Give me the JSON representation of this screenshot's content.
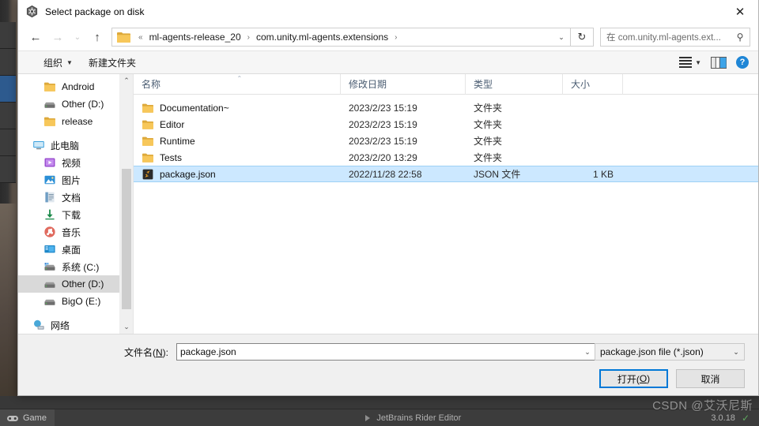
{
  "window": {
    "title": "Select package on disk",
    "app_icon": "unity-logo-icon",
    "close_label": "✕"
  },
  "nav": {
    "back_label": "←",
    "forward_label": "→",
    "recent_label": "⌄",
    "up_label": "↑",
    "refresh_label": "↻",
    "dropdown_label": "⌄",
    "breadcrumb": {
      "prefix": "«",
      "items": [
        "ml-agents-release_20",
        "com.unity.ml-agents.extensions"
      ],
      "separator": "›",
      "trailing_separator": "›"
    },
    "search": {
      "placeholder": "在 com.unity.ml-agents.ext...",
      "icon": "⚲"
    }
  },
  "command_bar": {
    "organize_label": "组织",
    "organize_caret": "▼",
    "new_folder_label": "新建文件夹",
    "view_caret": "▼",
    "help_label": "?"
  },
  "sidebar": {
    "items": [
      {
        "label": "Android",
        "icon": "folder-icon",
        "indent": true,
        "selected": false
      },
      {
        "label": "Other (D:)",
        "icon": "drive-icon",
        "indent": true,
        "selected": false
      },
      {
        "label": "release",
        "icon": "folder-icon",
        "indent": true,
        "selected": false
      },
      {
        "label": "此电脑",
        "icon": "this-pc-icon",
        "indent": false,
        "selected": false
      },
      {
        "label": "视频",
        "icon": "videos-icon",
        "indent": true,
        "selected": false
      },
      {
        "label": "图片",
        "icon": "pictures-icon",
        "indent": true,
        "selected": false
      },
      {
        "label": "文档",
        "icon": "documents-icon",
        "indent": true,
        "selected": false
      },
      {
        "label": "下载",
        "icon": "downloads-icon",
        "indent": true,
        "selected": false
      },
      {
        "label": "音乐",
        "icon": "music-icon",
        "indent": true,
        "selected": false
      },
      {
        "label": "桌面",
        "icon": "desktop-icon",
        "indent": true,
        "selected": false
      },
      {
        "label": "系统 (C:)",
        "icon": "system-drive-icon",
        "indent": true,
        "selected": false
      },
      {
        "label": "Other (D:)",
        "icon": "drive-icon",
        "indent": true,
        "selected": true
      },
      {
        "label": "BigO (E:)",
        "icon": "drive-icon",
        "indent": true,
        "selected": false
      },
      {
        "label": "网络",
        "icon": "network-icon",
        "indent": false,
        "selected": false
      }
    ],
    "scroll_up": "⌃",
    "scroll_down": "⌄"
  },
  "file_list": {
    "columns": [
      "名称",
      "修改日期",
      "类型",
      "大小"
    ],
    "sort_indicator": "⌃",
    "rows": [
      {
        "name": "Documentation~",
        "date": "2023/2/23 15:19",
        "type": "文件夹",
        "size": "",
        "icon": "folder-icon",
        "selected": false
      },
      {
        "name": "Editor",
        "date": "2023/2/23 15:19",
        "type": "文件夹",
        "size": "",
        "icon": "folder-icon",
        "selected": false
      },
      {
        "name": "Runtime",
        "date": "2023/2/23 15:19",
        "type": "文件夹",
        "size": "",
        "icon": "folder-icon",
        "selected": false
      },
      {
        "name": "Tests",
        "date": "2023/2/20 13:29",
        "type": "文件夹",
        "size": "",
        "icon": "folder-icon",
        "selected": false
      },
      {
        "name": "package.json",
        "date": "2022/11/28 22:58",
        "type": "JSON 文件",
        "size": "1 KB",
        "icon": "json-file-icon",
        "selected": true
      }
    ]
  },
  "footer": {
    "filename_label_prefix": "文件名(",
    "filename_label_accel": "N",
    "filename_label_suffix": "):",
    "filename_value": "package.json",
    "filter_value": "package.json file (*.json)",
    "filter_caret": "⌄",
    "open_prefix": "打开(",
    "open_accel": "O",
    "open_suffix": ")",
    "cancel_label": "取消"
  },
  "background": {
    "game_tab_label": "Game",
    "rider_label": "JetBrains Rider Editor",
    "rider_version": "3.0.18",
    "rider_check": "✓"
  },
  "watermark": {
    "text": "CSDN @艾沃尼斯"
  },
  "colors": {
    "accent": "#0078d7",
    "selection": "#cce8ff",
    "sidebar_selection": "#d9d9d9",
    "folder_yellow": "#f7c75a",
    "help_blue": "#1f86d6"
  }
}
